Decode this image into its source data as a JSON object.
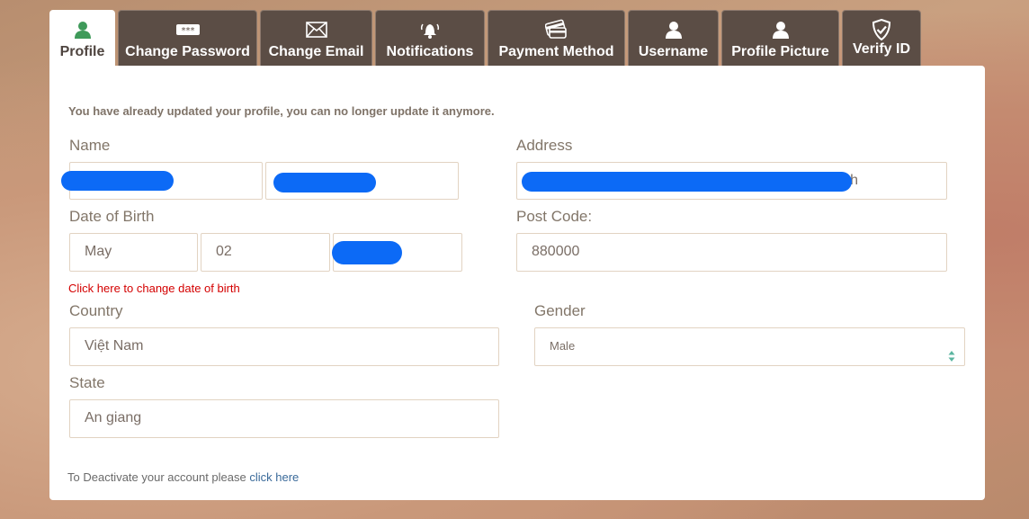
{
  "tabs": [
    {
      "label": "Profile",
      "icon": "user-icon",
      "active": true
    },
    {
      "label": "Change Password",
      "icon": "password-icon"
    },
    {
      "label": "Change Email",
      "icon": "envelope-icon"
    },
    {
      "label": "Notifications",
      "icon": "bell-icon"
    },
    {
      "label": "Payment Method",
      "icon": "credit-card-icon"
    },
    {
      "label": "Username",
      "icon": "user-icon"
    },
    {
      "label": "Profile Picture",
      "icon": "user-icon"
    },
    {
      "label": "Verify ID",
      "icon": "shield-check-icon"
    }
  ],
  "profile": {
    "notice": "You have already updated your profile, you can no longer update it anymore.",
    "name_label": "Name",
    "dob_label": "Date of Birth",
    "dob_month": "May",
    "dob_day": "02",
    "change_dob_link": "Click here to change date of birth",
    "address_label": "Address",
    "address_visible_tail": "h",
    "postcode_label": "Post Code:",
    "postcode_value": "880000",
    "country_label": "Country",
    "country_value": "Việt Nam",
    "gender_label": "Gender",
    "gender_value": "Male",
    "state_label": "State",
    "state_value": "An giang",
    "deactivate_text": "To Deactivate your account please",
    "deactivate_link": "click here"
  },
  "colors": {
    "tab_bg": "#5b4d45",
    "redaction": "#0c6af6",
    "link_red": "#d40000",
    "link_blue": "#3a6a9a",
    "profile_icon": "#3f9a5a"
  }
}
